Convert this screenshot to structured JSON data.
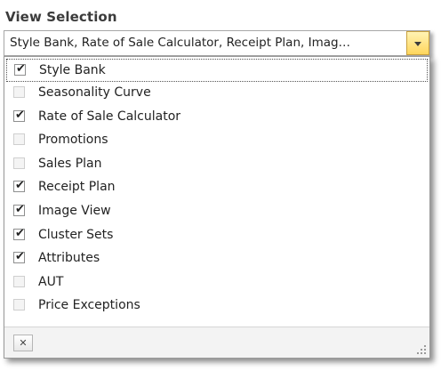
{
  "heading": "View Selection",
  "combo": {
    "text": "Style Bank, Rate of Sale Calculator, Receipt Plan, Imag…",
    "dropdown_icon": "chevron-down-icon"
  },
  "items": [
    {
      "label": "Style Bank",
      "checked": true
    },
    {
      "label": "Seasonality Curve",
      "checked": false
    },
    {
      "label": "Rate of Sale Calculator",
      "checked": true
    },
    {
      "label": "Promotions",
      "checked": false
    },
    {
      "label": "Sales Plan",
      "checked": false
    },
    {
      "label": "Receipt Plan",
      "checked": true
    },
    {
      "label": "Image View",
      "checked": true
    },
    {
      "label": "Cluster Sets",
      "checked": true
    },
    {
      "label": "Attributes",
      "checked": true
    },
    {
      "label": "AUT",
      "checked": false
    },
    {
      "label": "Price Exceptions",
      "checked": false
    }
  ],
  "footer": {
    "clear_icon": "close-icon",
    "resize_icon": "resize-grip-icon"
  },
  "colors": {
    "dropdown_button_top": "#fff3b4",
    "dropdown_button_bottom": "#ffd65c",
    "heading_text": "#3b3b3b"
  }
}
